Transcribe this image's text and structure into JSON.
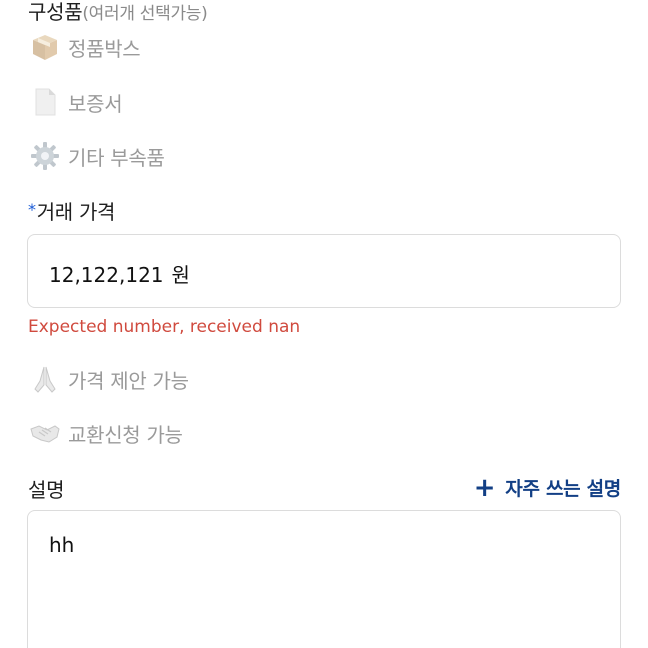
{
  "components": {
    "title": "구성품",
    "subtitle": "(여러개 선택가능)",
    "options": [
      {
        "label": "정품박스",
        "icon": "package-icon"
      },
      {
        "label": "보증서",
        "icon": "document-icon"
      },
      {
        "label": "기타 부속품",
        "icon": "gear-icon"
      }
    ]
  },
  "price": {
    "required_mark": "*",
    "title": "거래 가격",
    "value": "12,122,121",
    "unit": "원",
    "error": "Expected number, received nan"
  },
  "negotiation": {
    "offer_label": "가격 제안 가능",
    "offer_icon": "folded-hands-icon",
    "exchange_label": "교환신청 가능",
    "exchange_icon": "handshake-icon"
  },
  "description": {
    "title": "설명",
    "preset_plus": "+",
    "preset_label": "자주 쓰는 설명",
    "value": "hh"
  },
  "colors": {
    "error": "#d04a3e",
    "link": "#123f85",
    "required": "#1a5bd6",
    "border": "#dcdcdc"
  }
}
